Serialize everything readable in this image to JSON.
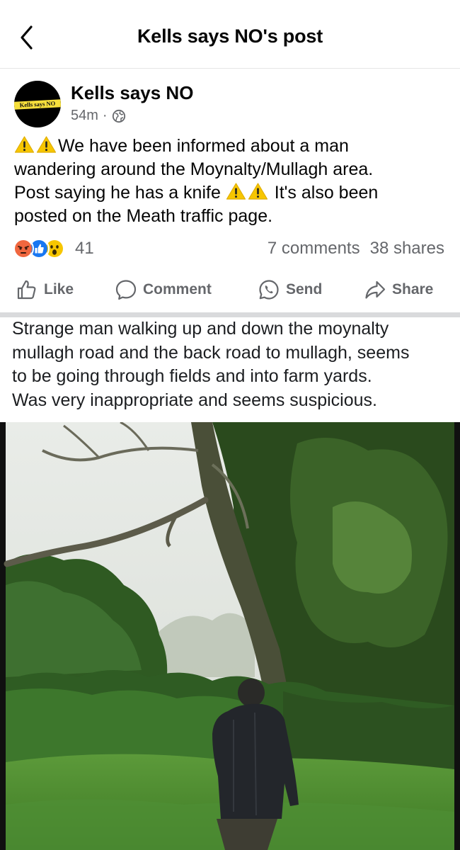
{
  "header": {
    "title": "Kells says NO's post"
  },
  "post": {
    "author": "Kells says NO",
    "avatar_text": "Kells says NO",
    "time": "54m",
    "dot": "·",
    "line1_text": "We have been informed about a man",
    "line2_text": "wandering around the Moynalty/Mullagh area.",
    "line3_text_a": "Post saying he has a knife",
    "line3_text_b": "It's also been",
    "line4_text": "posted on the Meath traffic page."
  },
  "engagement": {
    "reaction_count": "41",
    "comments": "7 comments",
    "shares": "38 shares",
    "reactions": [
      "angry-icon",
      "like-icon",
      "wow-icon"
    ]
  },
  "actions": {
    "like": "Like",
    "comment": "Comment",
    "send": "Send",
    "share": "Share"
  },
  "shared_post": {
    "line1": "Strange man walking up and down the moynalty",
    "line2": "mullagh road and the back road to mullagh, seems",
    "line3": "to be going through fields and into farm yards.",
    "line4": "Was very inappropriate and seems suspicious."
  },
  "colors": {
    "text_primary": "#050505",
    "text_secondary": "#65676b",
    "divider": "#d9dadc",
    "like_blue": "#1877f2",
    "warning_yellow": "#f7c600"
  }
}
